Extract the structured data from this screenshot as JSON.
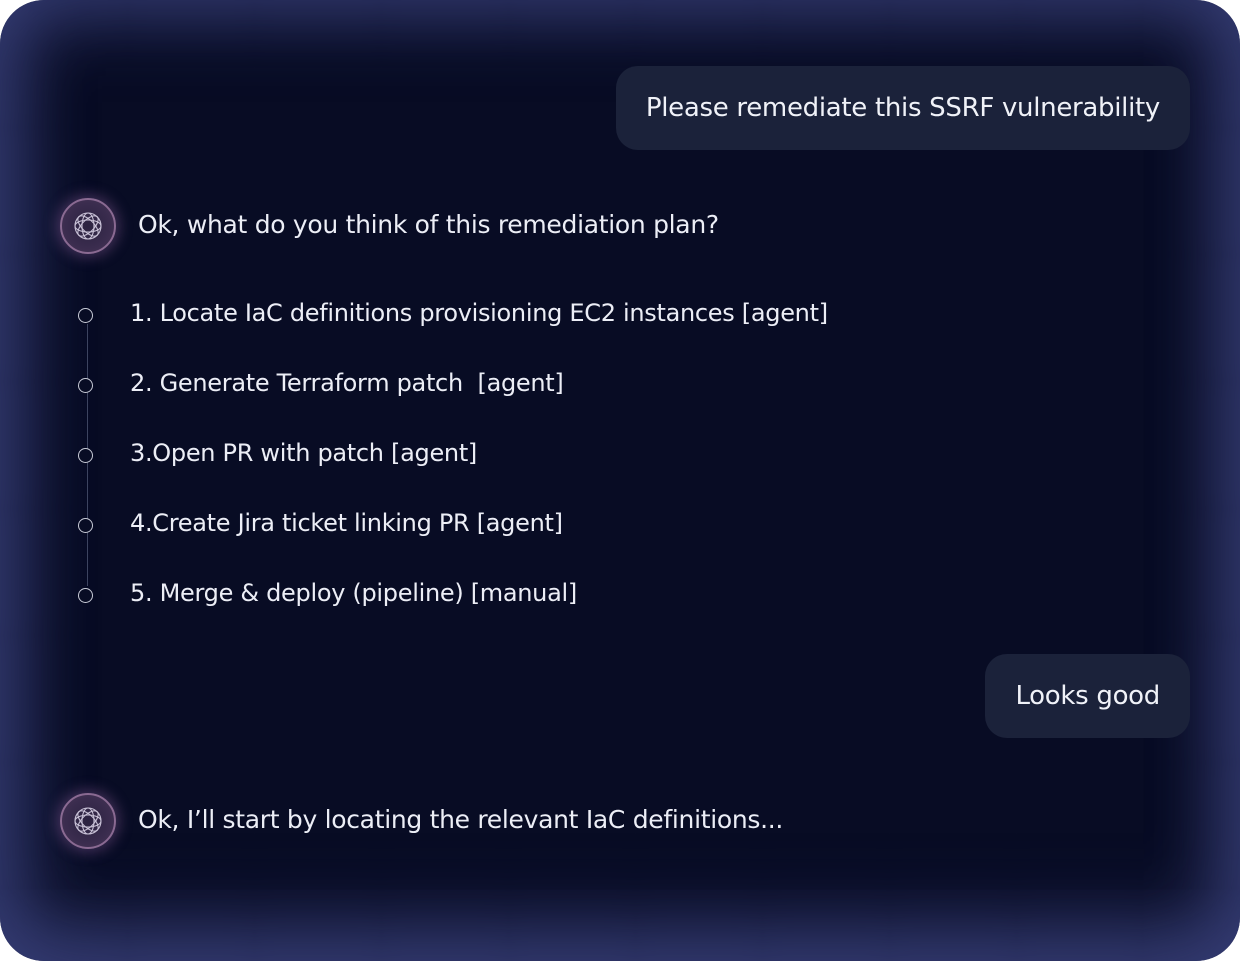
{
  "conversation": {
    "user_message_1": "Please remediate this SSRF vulnerability",
    "assistant_message_1": "Ok, what do you think of this remediation plan?",
    "plan_steps": [
      {
        "label": "1. Locate IaC definitions provisioning EC2 instances [agent]"
      },
      {
        "label": "2. Generate Terraform patch  [agent]"
      },
      {
        "label": "3.Open PR with patch [agent]"
      },
      {
        "label": "4.Create Jira ticket linking PR [agent]"
      },
      {
        "label": "5. Merge & deploy (pipeline) [manual]"
      }
    ],
    "user_message_2": "Looks good",
    "assistant_message_2": "Ok, I’ll start by locating the relevant IaC definitions..."
  },
  "icons": {
    "assistant_avatar": "orbital-sphere-icon",
    "step_marker": "circle-outline-icon"
  },
  "colors": {
    "background": "#080c24",
    "glow": "#3c4482",
    "bubble": "#1b223a",
    "text": "#eceef6",
    "avatar_ring": "#8a6a92"
  }
}
